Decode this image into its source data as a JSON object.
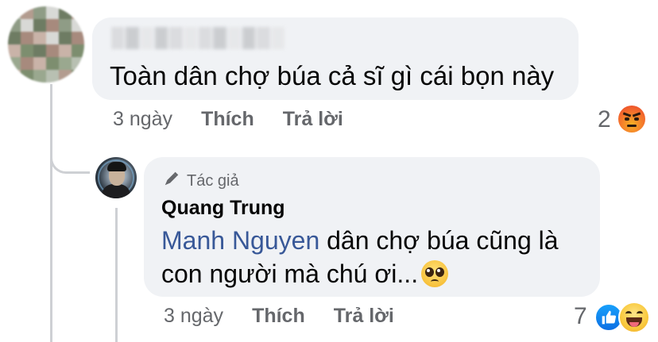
{
  "comment": {
    "author_blurred": true,
    "text": "Toàn dân chợ búa cả sĩ gì cái bọn này",
    "time": "3 ngày",
    "like_label": "Thích",
    "reply_label": "Trả lời",
    "reaction_count": "2",
    "reactions": [
      "angry-emoji"
    ]
  },
  "reply": {
    "badge_label": "Tác giả",
    "badge_icon": "pen-icon",
    "author": "Quang Trung",
    "mention": "Manh Nguyen",
    "text": " dân chợ búa cũng là con người mà chú ơi...",
    "time": "3 ngày",
    "like_label": "Thích",
    "reply_label": "Trả lời",
    "reaction_count": "7",
    "reactions": [
      "like-badge",
      "haha-emoji"
    ],
    "emoji_icon": "pleading-face-icon"
  },
  "colors": {
    "bubble": "#f0f2f5",
    "meta": "#65676b",
    "mention": "#385898",
    "like_blue": "#0c6fe3"
  }
}
